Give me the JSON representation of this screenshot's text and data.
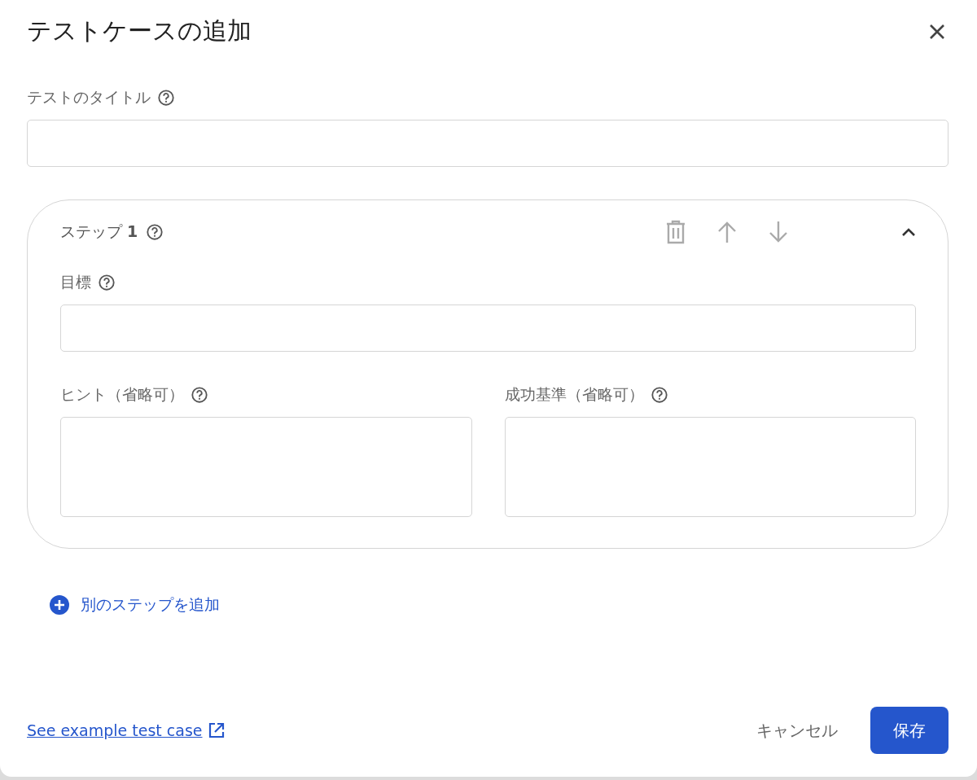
{
  "dialog": {
    "title": "テストケースの追加"
  },
  "title_field": {
    "label": "テストのタイトル"
  },
  "steps": [
    {
      "label": "ステップ **1**",
      "expanded": true,
      "fields": [
        {
          "label": "目標",
          "kind": "line"
        },
        {
          "label": "ヒント（省略可）",
          "kind": "area"
        },
        {
          "label": "成功基準（省略可）",
          "kind": "area"
        }
      ]
    }
  ],
  "add_step": "別のステップを追加",
  "example_link": "See example test case",
  "buttons": [
    {
      "label": "キャンセル",
      "kind": "text"
    },
    {
      "label": "保存",
      "kind": "filled"
    }
  ]
}
